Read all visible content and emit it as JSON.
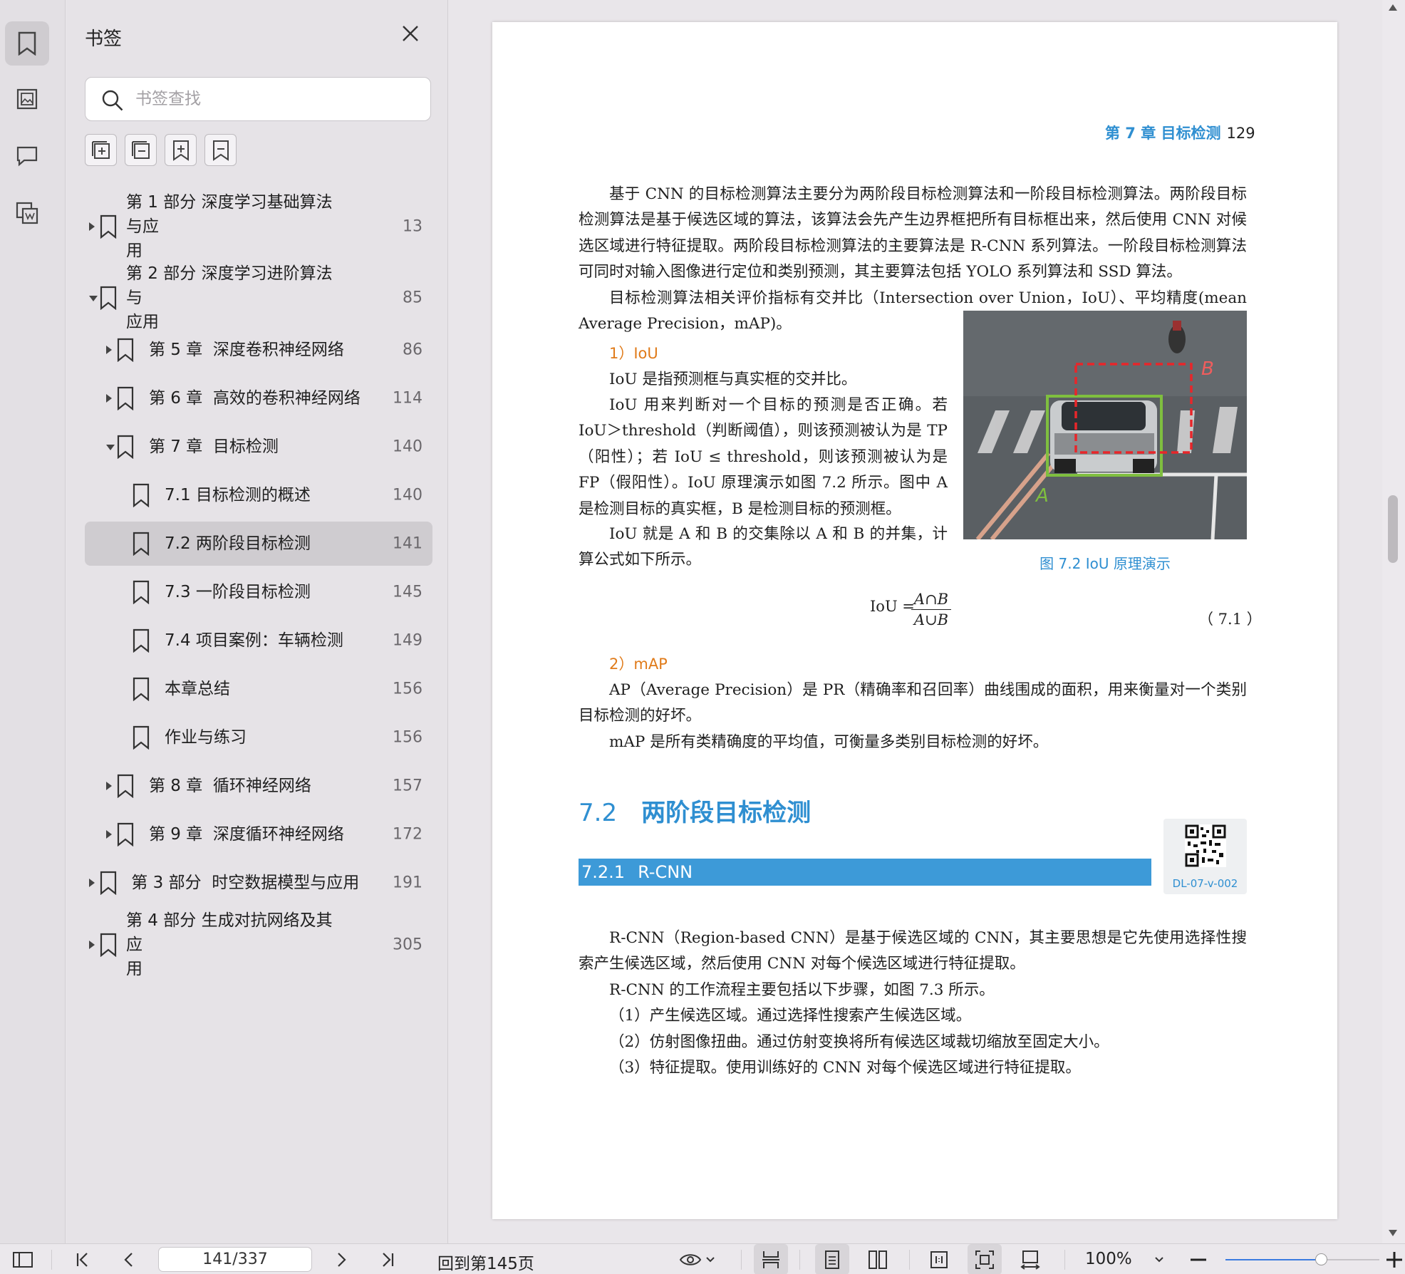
{
  "sidebar": {
    "title": "书签",
    "search_placeholder": "书签查找",
    "bookmarks": [
      {
        "label": "第 1 部分  深度学习基础算法与应用",
        "page": "13",
        "level": 0,
        "expander": "right",
        "line1": "第 1 部分  深度学习基础算法与应",
        "line2": "用"
      },
      {
        "label": "第 2 部分  深度学习进阶算法与应用",
        "page": "85",
        "level": 0,
        "expander": "down",
        "line1": " 第 2 部分  深度学习进阶算法与",
        "line2": "应用"
      },
      {
        "label": "第 5 章  深度卷积神经网络",
        "page": "86",
        "level": 1,
        "expander": "right"
      },
      {
        "label": "第 6 章  高效的卷积神经网络",
        "page": "114",
        "level": 1,
        "expander": "right"
      },
      {
        "label": "第 7 章  目标检测",
        "page": "140",
        "level": 1,
        "expander": "down"
      },
      {
        "label": "7.1 目标检测的概述",
        "page": "140",
        "level": 2,
        "expander": ""
      },
      {
        "label": "7.2 两阶段目标检测",
        "page": "141",
        "level": 2,
        "expander": "",
        "selected": true
      },
      {
        "label": "7.3 一阶段目标检测",
        "page": "145",
        "level": 2,
        "expander": ""
      },
      {
        "label": "7.4 项目案例：车辆检测",
        "page": "149",
        "level": 2,
        "expander": ""
      },
      {
        "label": "本章总结",
        "page": "156",
        "level": 2,
        "expander": ""
      },
      {
        "label": "作业与练习",
        "page": "156",
        "level": 2,
        "expander": ""
      },
      {
        "label": "第 8 章  循环神经网络",
        "page": "157",
        "level": 1,
        "expander": "right"
      },
      {
        "label": "第 9 章  深度循环神经网络",
        "page": "172",
        "level": 1,
        "expander": "right"
      },
      {
        "label": " 第 3 部分  时空数据模型与应用",
        "page": "191",
        "level": 0,
        "expander": "right"
      },
      {
        "label": "第 4 部分  生成对抗网络及其应用",
        "page": "305",
        "level": 0,
        "expander": "right",
        "line1": " 第 4 部分  生成对抗网络及其应",
        "line2": "用"
      }
    ]
  },
  "page": {
    "running_head_chapter": "第 7 章    目标检测",
    "running_head_number": "129",
    "paragraphs": [
      "基于 CNN 的目标检测算法主要分为两阶段目标检测算法和一阶段目标检测算法。两阶段目标检测算法是基于候选区域的算法，该算法会先产生边界框把所有目标框出来，然后使用 CNN 对候选区域进行特征提取。两阶段目标检测算法的主要算法是 R-CNN 系列算法。一阶段目标检测算法可同时对输入图像进行定位和类别预测，其主要算法包括 YOLO 系列算法和 SSD 算法。",
      "目标检测算法相关评价指标有交并比（Intersection over Union，IoU）、平均精度(mean Average Precision，mAP)。"
    ],
    "iou_heading": "1）IoU",
    "iou_paragraphs": [
      "IoU 是指预测框与真实框的交并比。",
      "IoU 用来判断对一个目标的预测是否正确。若 IoU＞threshold（判断阈值），则该预测被认为是 TP（阳性）；若 IoU ≤ threshold，则该预测被认为是 FP（假阳性）。IoU 原理演示如图 7.2 所示。图中 A 是检测目标的真实框，B 是检测目标的预测框。",
      "IoU 就是 A 和 B 的交集除以 A 和 B 的并集，计算公式如下所示。"
    ],
    "figure_caption": "图 7.2    IoU 原理演示",
    "figure_label_a": "A",
    "figure_label_b": "B",
    "formula_lhs": "IoU =",
    "formula_num": "A∩B",
    "formula_den": "A∪B",
    "equation_number": "（ 7.1 ）",
    "map_heading": "2）mAP",
    "map_paragraphs": [
      "AP（Average Precision）是 PR（精确率和召回率）曲线围成的面积，用来衡量对一个类别目标检测的好坏。",
      "mAP 是所有类精确度的平均值，可衡量多类别目标检测的好坏。"
    ],
    "section_number": "7.2",
    "section_title": "两阶段目标检测",
    "qr_label": "DL-07-v-002",
    "subsection_number": "7.2.1",
    "subsection_title": "R-CNN",
    "rcnn_paragraphs": [
      "R-CNN（Region-based CNN）是基于候选区域的 CNN，其主要思想是它先使用选择性搜索产生候选区域，然后使用 CNN 对每个候选区域进行特征提取。",
      "R-CNN 的工作流程主要包括以下步骤，如图 7.3 所示。",
      "（1）产生候选区域。通过选择性搜索产生候选区域。",
      "（2）仿射图像扭曲。通过仿射变换将所有候选区域裁切缩放至固定大小。",
      "（3）特征提取。使用训练好的 CNN 对每个候选区域进行特征提取。"
    ]
  },
  "toolbar": {
    "page_indicator": "141/337",
    "goto_label": "回到第145页",
    "zoom_label": "100%",
    "zoom_value": 0.62
  }
}
